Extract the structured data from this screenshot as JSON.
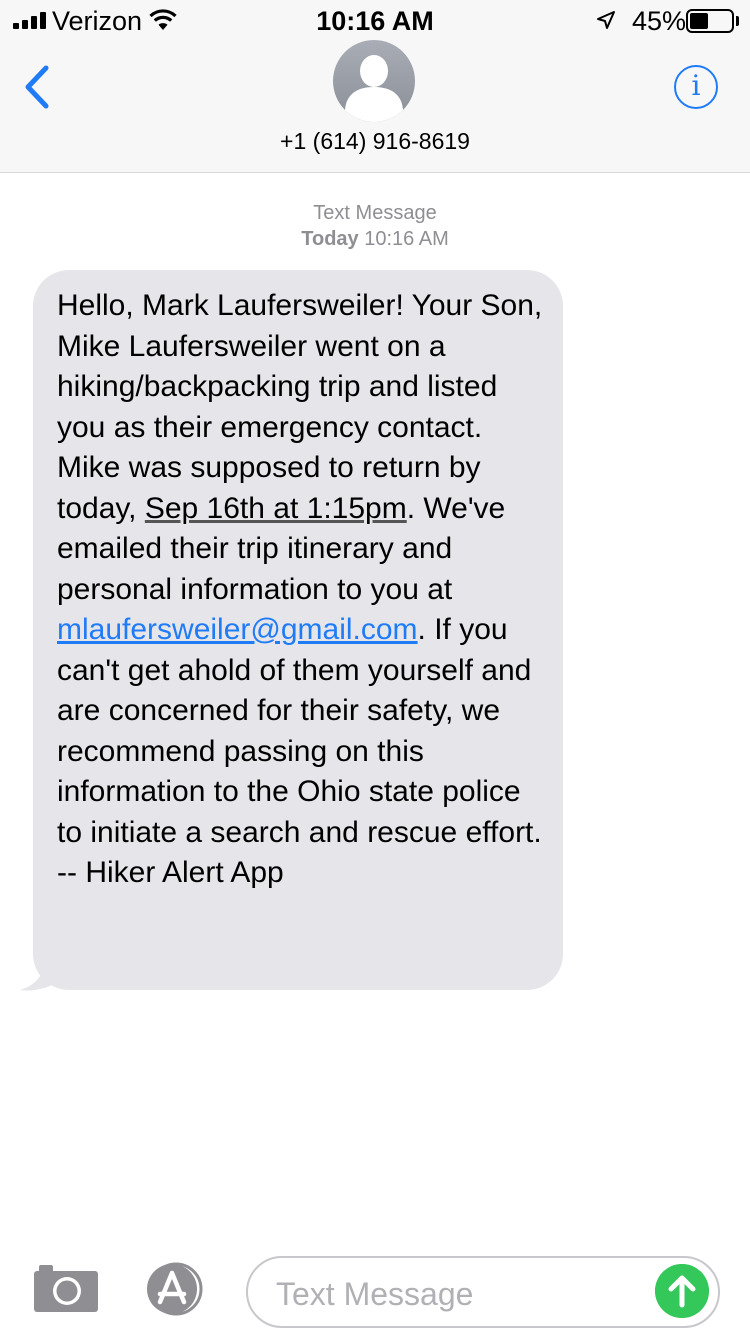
{
  "status_bar": {
    "carrier": "Verizon",
    "time": "10:16 AM",
    "battery_percent": "45%",
    "battery_level": 0.45,
    "icons": [
      "signal-icon",
      "wifi-icon",
      "location-arrow-icon",
      "battery-icon"
    ]
  },
  "header": {
    "contact": "+1 (614) 916-8619",
    "icons": [
      "back-chevron-icon",
      "contact-avatar-icon",
      "info-icon"
    ],
    "info_glyph": "i"
  },
  "conversation": {
    "service": "Text Message",
    "day": "Today",
    "time": "10:16 AM",
    "message": {
      "part1": "Hello, Mark Laufersweiler! Your Son, Mike Laufersweiler went on a hiking/backpacking trip and listed you as their emergency contact. Mike was supposed to return by today, ",
      "date_link": "Sep 16th at 1:15pm",
      "part2": ". We've emailed their trip itinerary and personal information to you at ",
      "email": "mlaufersweiler@gmail.com",
      "part3": ". If you can't get ahold of them yourself and are concerned for their safety, we recommend passing on this information to the Ohio state police to initiate a search and rescue effort. -- Hiker Alert App"
    }
  },
  "compose": {
    "placeholder": "Text Message",
    "icons": [
      "camera-icon",
      "app-store-icon",
      "send-arrow-icon"
    ]
  },
  "colors": {
    "accent": "#1f7cf6",
    "bubble": "#e5e5ea",
    "send": "#34c759",
    "meta_text": "#8e8e93"
  }
}
